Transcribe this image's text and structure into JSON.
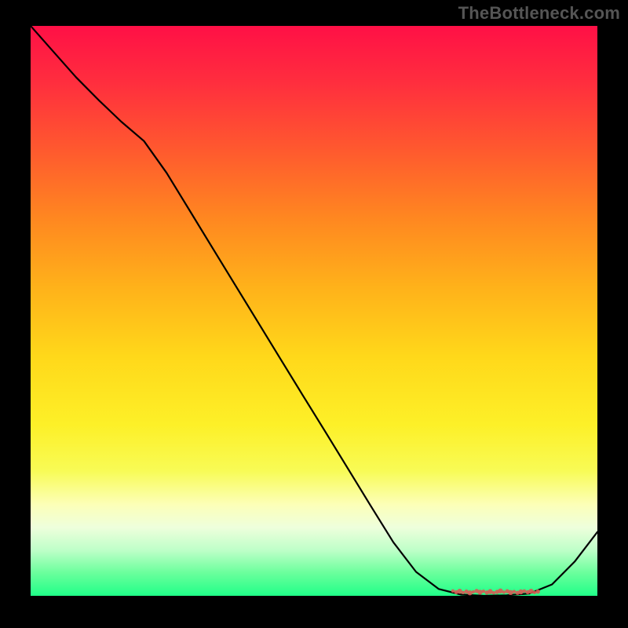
{
  "attribution": "TheBottleneck.com",
  "chart_data": {
    "type": "line",
    "title": "",
    "xlabel": "",
    "ylabel": "",
    "x": [
      0.0,
      0.04,
      0.08,
      0.12,
      0.16,
      0.2,
      0.24,
      0.28,
      0.32,
      0.36,
      0.4,
      0.44,
      0.48,
      0.52,
      0.56,
      0.6,
      0.64,
      0.68,
      0.72,
      0.76,
      0.8,
      0.84,
      0.88,
      0.92,
      0.96,
      1.0
    ],
    "values": [
      1.0,
      0.955,
      0.91,
      0.87,
      0.832,
      0.798,
      0.742,
      0.677,
      0.612,
      0.547,
      0.482,
      0.417,
      0.352,
      0.288,
      0.223,
      0.158,
      0.094,
      0.042,
      0.012,
      0.002,
      0.0,
      0.001,
      0.004,
      0.02,
      0.06,
      0.112
    ],
    "xlim": [
      0,
      1
    ],
    "ylim": [
      0,
      1
    ],
    "line_color": "#000000",
    "marker_zone": {
      "x0": 0.745,
      "x1": 0.895
    },
    "marker_color": "#d85a54"
  },
  "colors": {
    "bg": "#000000",
    "attribution_text": "#555555"
  }
}
